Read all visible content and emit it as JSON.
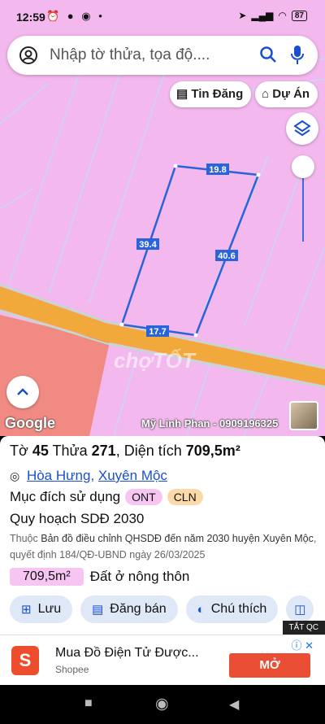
{
  "status": {
    "time": "12:59",
    "battery": "87"
  },
  "search": {
    "placeholder": "Nhập tờ thửa, tọa độ...."
  },
  "map": {
    "buttons": {
      "listings": "Tin Đăng",
      "projects": "Dự Án"
    },
    "edge_labels": {
      "top": "19.8",
      "left": "39.4",
      "right": "40.6",
      "bottom": "17.7"
    },
    "watermark": "chợTỐT",
    "google": "Google",
    "owner": "Mỹ Linh Phan - 0909196325"
  },
  "parcel": {
    "title_prefix": "Tờ",
    "sheet_no": "45",
    "plot_label": "Thửa",
    "plot_no": "271",
    "area_label": "Diện tích",
    "area_value": "709,5m²",
    "commune": "Hòa Hưng",
    "district": "Xuyên Mộc",
    "purpose_label": "Mục đích sử dụng",
    "purpose_tags": [
      "ONT",
      "CLN"
    ],
    "plan_label": "Quy hoạch SDĐ 2030",
    "note_prefix": "Thuộc",
    "note_doc": "Bản đồ điều chỉnh QHSDĐ đến năm 2030 huyện Xuyên Mộc",
    "note_decision": ", quyết định 184/QĐ-UBND ngày 26/03/2025",
    "area_chip": "709,5m²",
    "area_type": "Đất ở nông thôn"
  },
  "actions": {
    "save": "Lưu",
    "sell": "Đăng bán",
    "note": "Chú thích"
  },
  "ad": {
    "close": "TẮT QC",
    "headline": "Mua Đồ Điện Tử Được...",
    "brand": "Shopee",
    "cta": "MỞ"
  },
  "colors": {
    "map_bg": "#f3b8ee",
    "road": "#f2a93b",
    "parcel_line": "#2b63d9",
    "accent": "#1a4fd0",
    "cta": "#ea4e34"
  }
}
